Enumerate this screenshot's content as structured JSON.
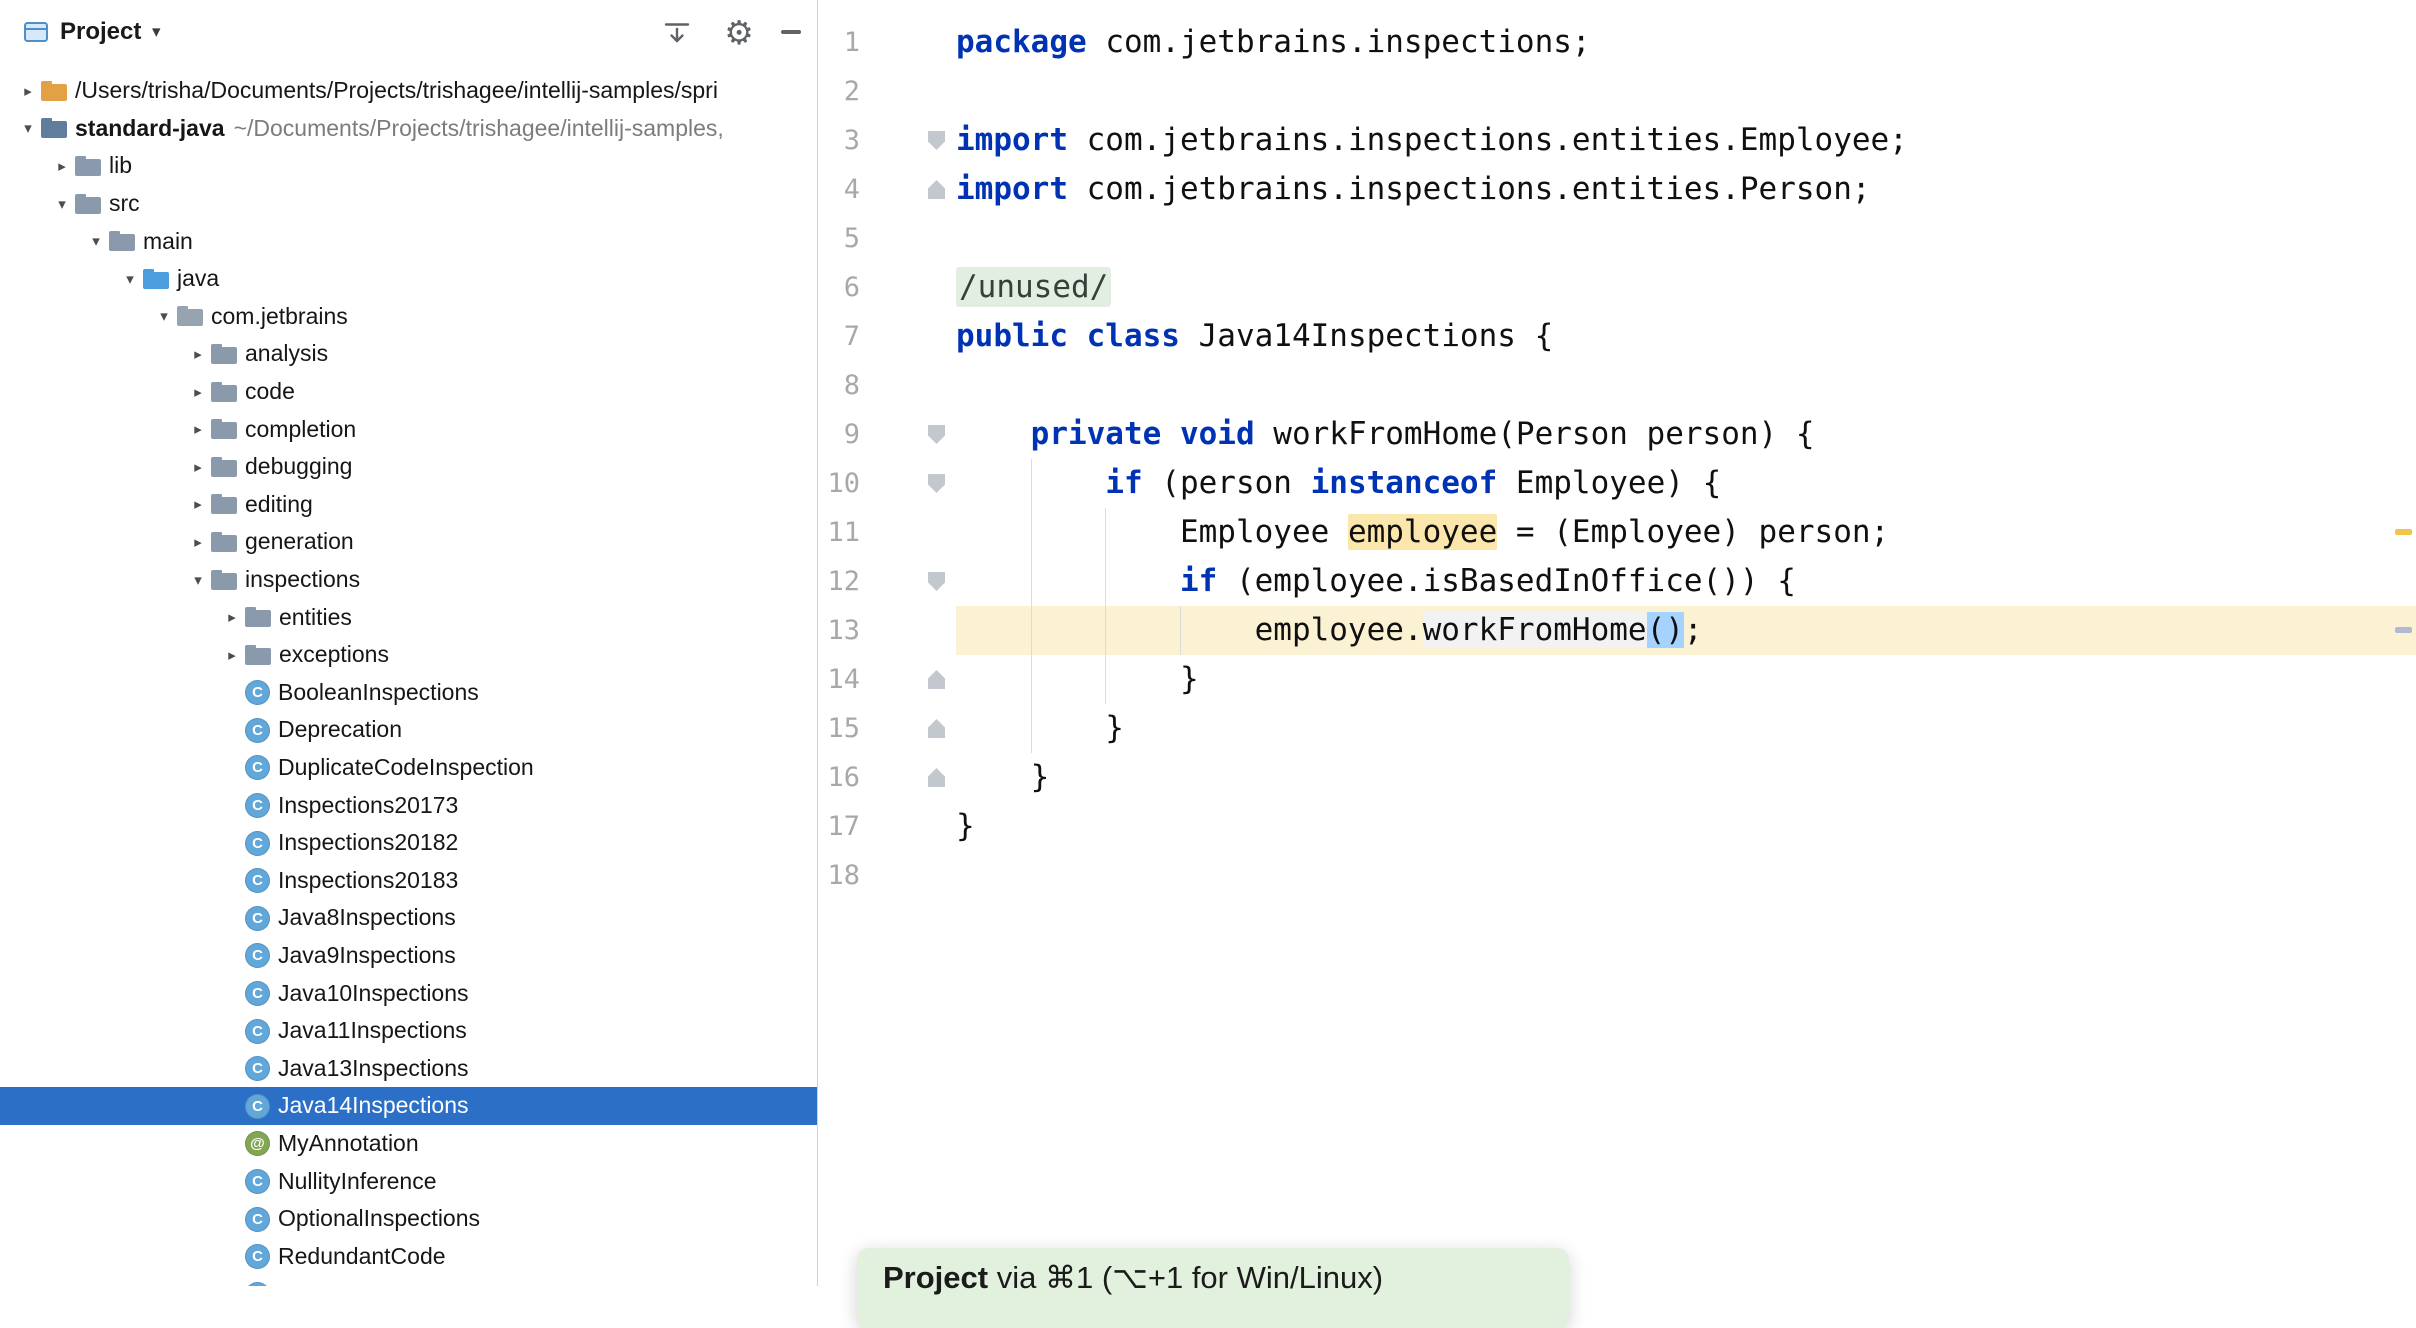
{
  "project_panel": {
    "title": "Project",
    "header_icons": [
      "collapse-all-icon",
      "gear-icon",
      "hide-panel-icon"
    ],
    "tree": [
      {
        "label": "/Users/trisha/Documents/Projects/trishagee/intellij-samples/spri",
        "level": 0,
        "arrow": "collapsed",
        "icon": "folder-orange"
      },
      {
        "label": "standard-java",
        "suffix": "~/Documents/Projects/trishagee/intellij-samples,",
        "level": 0,
        "arrow": "expanded",
        "icon": "folder-module",
        "bold": true
      },
      {
        "label": "lib",
        "level": 1,
        "arrow": "collapsed",
        "icon": "folder"
      },
      {
        "label": "src",
        "level": 1,
        "arrow": "expanded",
        "icon": "folder"
      },
      {
        "label": "main",
        "level": 2,
        "arrow": "expanded",
        "icon": "folder"
      },
      {
        "label": "java",
        "level": 3,
        "arrow": "expanded",
        "icon": "folder-source"
      },
      {
        "label": "com.jetbrains",
        "level": 4,
        "arrow": "expanded",
        "icon": "package"
      },
      {
        "label": "analysis",
        "level": 5,
        "arrow": "collapsed",
        "icon": "folder"
      },
      {
        "label": "code",
        "level": 5,
        "arrow": "collapsed",
        "icon": "folder"
      },
      {
        "label": "completion",
        "level": 5,
        "arrow": "collapsed",
        "icon": "folder"
      },
      {
        "label": "debugging",
        "level": 5,
        "arrow": "collapsed",
        "icon": "folder"
      },
      {
        "label": "editing",
        "level": 5,
        "arrow": "collapsed",
        "icon": "folder"
      },
      {
        "label": "generation",
        "level": 5,
        "arrow": "collapsed",
        "icon": "folder"
      },
      {
        "label": "inspections",
        "level": 5,
        "arrow": "expanded",
        "icon": "folder"
      },
      {
        "label": "entities",
        "level": 6,
        "arrow": "collapsed",
        "icon": "folder"
      },
      {
        "label": "exceptions",
        "level": 6,
        "arrow": "collapsed",
        "icon": "folder"
      },
      {
        "label": "BooleanInspections",
        "level": 6,
        "icon": "class"
      },
      {
        "label": "Deprecation",
        "level": 6,
        "icon": "class"
      },
      {
        "label": "DuplicateCodeInspection",
        "level": 6,
        "icon": "class"
      },
      {
        "label": "Inspections20173",
        "level": 6,
        "icon": "class"
      },
      {
        "label": "Inspections20182",
        "level": 6,
        "icon": "class"
      },
      {
        "label": "Inspections20183",
        "level": 6,
        "icon": "class"
      },
      {
        "label": "Java8Inspections",
        "level": 6,
        "icon": "class"
      },
      {
        "label": "Java9Inspections",
        "level": 6,
        "icon": "class"
      },
      {
        "label": "Java10Inspections",
        "level": 6,
        "icon": "class"
      },
      {
        "label": "Java11Inspections",
        "level": 6,
        "icon": "class"
      },
      {
        "label": "Java13Inspections",
        "level": 6,
        "icon": "class"
      },
      {
        "label": "Java14Inspections",
        "level": 6,
        "icon": "class",
        "selected": true
      },
      {
        "label": "MyAnnotation",
        "level": 6,
        "icon": "annotation"
      },
      {
        "label": "NullityInference",
        "level": 6,
        "icon": "class"
      },
      {
        "label": "OptionalInspections",
        "level": 6,
        "icon": "class"
      },
      {
        "label": "RedundantCode",
        "level": 6,
        "icon": "class"
      },
      {
        "label": "",
        "level": 6,
        "icon": "class"
      }
    ]
  },
  "editor": {
    "caret_line": 13,
    "lines": [
      {
        "num": 1,
        "tokens": [
          {
            "c": "kw",
            "t": "package"
          },
          {
            "c": "pl",
            "t": " com.jetbrains.inspections;"
          }
        ]
      },
      {
        "num": 2,
        "tokens": []
      },
      {
        "num": 3,
        "fold": "start",
        "tokens": [
          {
            "c": "kw",
            "t": "import"
          },
          {
            "c": "pl",
            "t": " com.jetbrains.inspections.entities.Employee;"
          }
        ]
      },
      {
        "num": 4,
        "fold": "end",
        "tokens": [
          {
            "c": "kw",
            "t": "import"
          },
          {
            "c": "pl",
            "t": " com.jetbrains.inspections.entities.Person;"
          }
        ]
      },
      {
        "num": 5,
        "tokens": []
      },
      {
        "num": 6,
        "tokens": [
          {
            "c": "folded",
            "t": "/unused/"
          }
        ]
      },
      {
        "num": 7,
        "tokens": [
          {
            "c": "kw",
            "t": "public class"
          },
          {
            "c": "pl",
            "t": " Java14Inspections {"
          }
        ]
      },
      {
        "num": 8,
        "tokens": []
      },
      {
        "num": 9,
        "fold": "start",
        "tokens": [
          {
            "c": "pl",
            "t": "    "
          },
          {
            "c": "kw",
            "t": "private void"
          },
          {
            "c": "pl",
            "t": " workFromHome(Person person) {"
          }
        ]
      },
      {
        "num": 10,
        "fold": "start",
        "tokens": [
          {
            "c": "pl",
            "t": "        "
          },
          {
            "c": "kw",
            "t": "if"
          },
          {
            "c": "pl",
            "t": " (person "
          },
          {
            "c": "kw",
            "t": "instanceof"
          },
          {
            "c": "pl",
            "t": " Employee) {"
          }
        ]
      },
      {
        "num": 11,
        "tokens": [
          {
            "c": "pl",
            "t": "            Employee "
          },
          {
            "c": "hlw",
            "t": "employee"
          },
          {
            "c": "pl",
            "t": " = (Employee) person;"
          }
        ]
      },
      {
        "num": 12,
        "fold": "start",
        "tokens": [
          {
            "c": "pl",
            "t": "            "
          },
          {
            "c": "kw",
            "t": "if"
          },
          {
            "c": "pl",
            "t": " (employee.isBasedInOffice()) {"
          }
        ]
      },
      {
        "num": 13,
        "tokens": [
          {
            "c": "pl",
            "t": "                employee."
          },
          {
            "c": "hlr",
            "t": "workFromHome"
          },
          {
            "c": "sel",
            "t": "()"
          },
          {
            "c": "pl",
            "t": ";"
          }
        ]
      },
      {
        "num": 14,
        "fold": "end",
        "tokens": [
          {
            "c": "pl",
            "t": "            }"
          }
        ]
      },
      {
        "num": 15,
        "fold": "end",
        "tokens": [
          {
            "c": "pl",
            "t": "        }"
          }
        ]
      },
      {
        "num": 16,
        "fold": "end",
        "tokens": [
          {
            "c": "pl",
            "t": "    }"
          }
        ]
      },
      {
        "num": 17,
        "tokens": [
          {
            "c": "pl",
            "t": "}"
          }
        ]
      },
      {
        "num": 18,
        "tokens": []
      }
    ],
    "error_stripe": [
      {
        "line": 11,
        "color": "#EFC54A"
      },
      {
        "line": 13,
        "color": "#B4B9D2"
      }
    ]
  },
  "tooltip": {
    "text_bold": "Project",
    "text_rest": " via ⌘1 (⌥+1 for Win/Linux)"
  },
  "colors": {
    "tree_selection": "#2B70C6",
    "caret_line": "#FAF2D2",
    "write_usage_highlight": "#FBE7AC",
    "text_selection": "#A6D2FF",
    "keyword": "#0033B3",
    "folded_text_bg": "#E3EEE3",
    "tooltip_bg": "#E1F1DE"
  }
}
